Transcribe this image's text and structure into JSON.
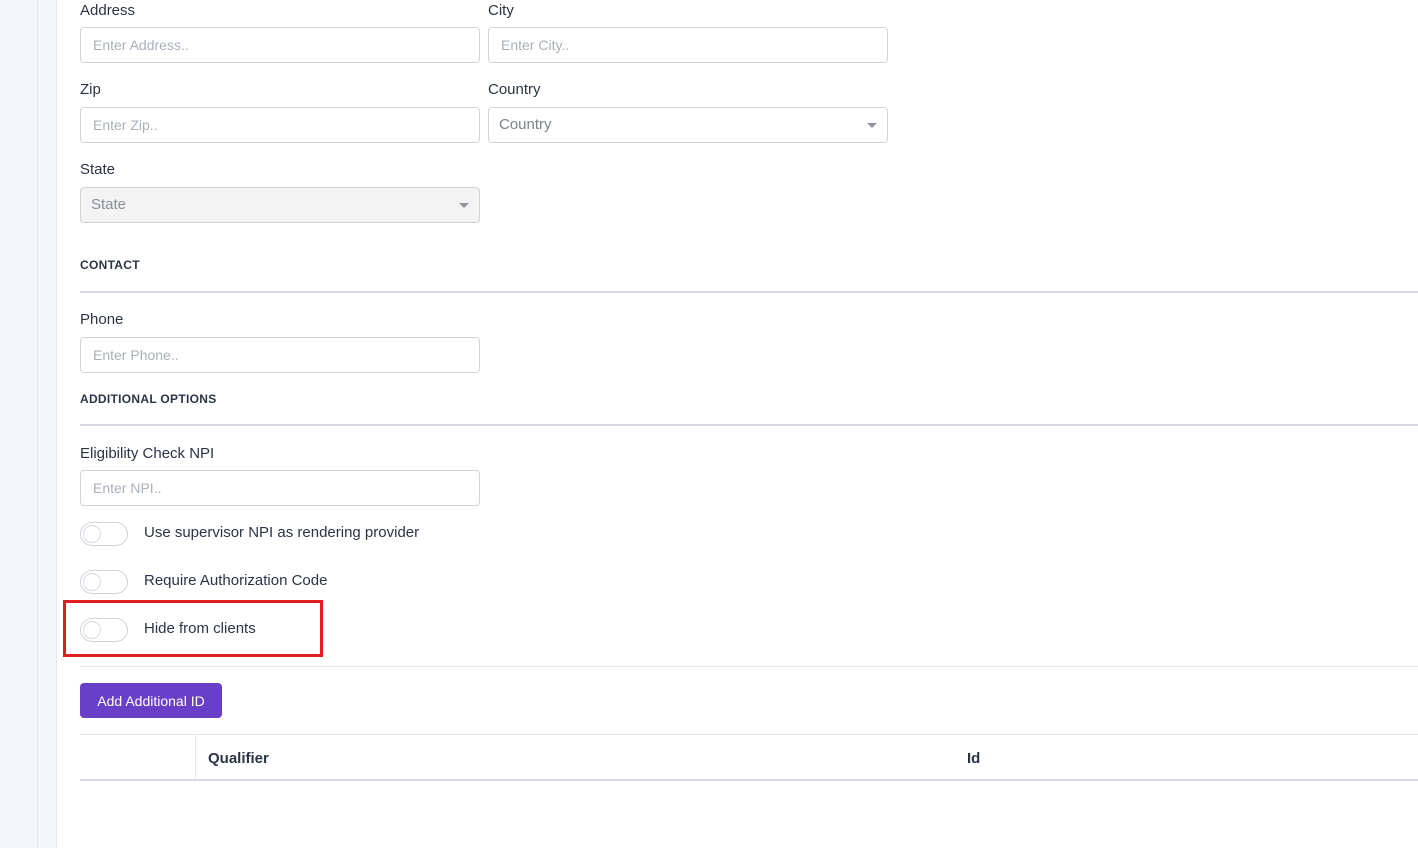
{
  "address": {
    "address_label": "Address",
    "address_placeholder": "Enter Address..",
    "city_label": "City",
    "city_placeholder": "Enter City..",
    "zip_label": "Zip",
    "zip_placeholder": "Enter Zip..",
    "country_label": "Country",
    "country_value": "Country",
    "state_label": "State",
    "state_value": "State"
  },
  "contact": {
    "section_title": "CONTACT",
    "phone_label": "Phone",
    "phone_placeholder": "Enter Phone.."
  },
  "additional_options": {
    "section_title": "ADDITIONAL OPTIONS",
    "npi_label": "Eligibility Check NPI",
    "npi_placeholder": "Enter NPI..",
    "toggles": [
      {
        "label": "Use supervisor NPI as rendering provider",
        "on": false
      },
      {
        "label": "Require Authorization Code",
        "on": false
      },
      {
        "label": "Hide from clients",
        "on": false
      }
    ]
  },
  "additional_ids": {
    "add_button_label": "Add Additional ID",
    "columns": [
      "Qualifier",
      "Id"
    ]
  },
  "colors": {
    "accent": "#6a3fc8",
    "highlight": "#dd1e1e"
  }
}
